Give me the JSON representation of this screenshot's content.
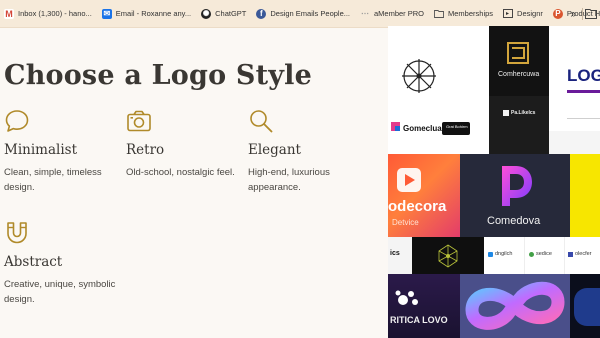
{
  "bookmarks": [
    {
      "label": "Inbox (1,300) - hano...",
      "icon": "gmail-icon",
      "color": "#d44638"
    },
    {
      "label": "Email - Roxanne any...",
      "icon": "outlook-icon",
      "color": "#1a73e8"
    },
    {
      "label": "ChatGPT",
      "icon": "chatgpt-icon",
      "color": "#222222"
    },
    {
      "label": "Design Emails People...",
      "icon": "facebook-icon",
      "color": "#3b5998"
    },
    {
      "label": "aMember PRO",
      "icon": "amember-icon",
      "color": "#9a9a9a"
    },
    {
      "label": "Memberships",
      "icon": "folder-icon",
      "color": "#555555"
    },
    {
      "label": "Designr",
      "icon": "designr-icon",
      "color": "#333333"
    },
    {
      "label": "Product Hunt",
      "icon": "producthunt-icon",
      "color": "#da552f"
    }
  ],
  "bookmarks_more": "»",
  "page": {
    "title": "Choose a Logo Style",
    "styles": [
      {
        "name": "Minimalist",
        "desc": "Clean, simple, timeless design.",
        "icon": "speech-bubble-icon"
      },
      {
        "name": "Retro",
        "desc": "Old-school, nostalgic feel.",
        "icon": "camera-icon"
      },
      {
        "name": "Elegant",
        "desc": "High-end, luxurious appearance.",
        "icon": "magnifier-icon"
      },
      {
        "name": "Abstract",
        "desc": "Creative, unique, symbolic design.",
        "icon": "magnet-icon"
      }
    ]
  },
  "gallery": {
    "brand_comhercuwa": "Comhercuwa",
    "brand_logo": "LOG",
    "brand_palikets": "Pa.Likelcs",
    "brand_gomeclua": "Gomeclua",
    "brand_badge": "Grat Bohirm",
    "brand_odecora": "odecora",
    "brand_odecora_sub": "Detvice",
    "brand_comedova": "Comedova",
    "brand_ics": "ics",
    "brand_dngilch": "dngilch",
    "brand_sedice": "sedice",
    "brand_olecfer": "olecfer",
    "brand_ritica": "RITICA LOVO"
  },
  "colors": {
    "page_bg": "#fbf8f4",
    "bookmarks_bg": "#f6ead9",
    "icon_gold": "#b08a2a",
    "title_text": "#3a3733"
  }
}
